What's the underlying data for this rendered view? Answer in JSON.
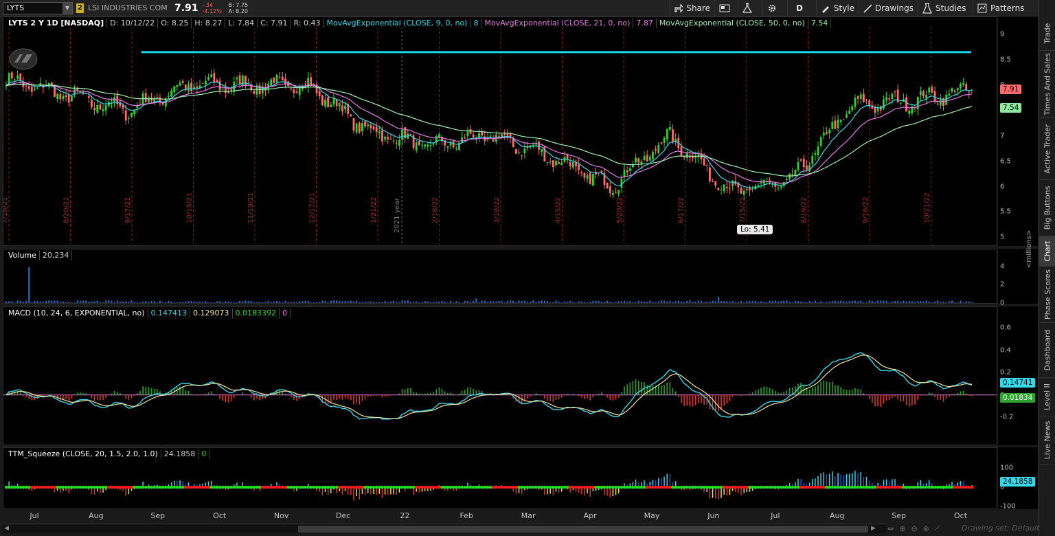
{
  "toolbar": {
    "symbol": "LYTS",
    "link_badge": "2",
    "company": "LSI INDUSTRIES COM",
    "last": "7.91",
    "change": "-.34",
    "change_pct": "-4.12%",
    "bid": "B: 7.75",
    "ask": "A: 8.20",
    "share": "Share",
    "period": "D",
    "style": "Style",
    "drawings": "Drawings",
    "studies": "Studies",
    "patterns": "Patterns"
  },
  "rail": [
    "Trade",
    "Times And Sales",
    "Active Trader",
    "Big Buttons",
    "Chart",
    "Phase Scores",
    "Dashboard",
    "Level II",
    "Live News"
  ],
  "price_panel": {
    "title": "LYTS 2 Y 1D [NASDAQ]",
    "date": "D: 10/12/22",
    "open": "O: 8.25",
    "high": "H: 8.27",
    "low": "L: 7.84",
    "close": "C: 7.91",
    "range": "R: 0.43",
    "ema9": "MovAvgExponential (CLOSE, 9, 0, no)",
    "ema9_val": "8",
    "ema21": "MovAvgExponential (CLOSE, 21, 0, no)",
    "ema21_val": "7.87",
    "ema50": "MovAvgExponential (CLOSE, 50, 0, no)",
    "ema50_val": "7.54",
    "axis": [
      "9",
      "8.5",
      "8",
      "7.5",
      "7",
      "6.5",
      "6",
      "5.5",
      "5"
    ],
    "tag_last": "7.91",
    "tag_ema": "7.54",
    "lo_label": "Lo: 5.41",
    "expiry_labels": [
      "7/16/21",
      "8/20/21",
      "9/17/21",
      "10/15/21",
      "11/19/21",
      "12/17/21",
      "1/21/22",
      "2/18/22",
      "3/18/22",
      "4/15/22",
      "5/20/22",
      "6/17/22",
      "7/15/22",
      "8/19/22",
      "9/16/22",
      "10/21/22"
    ],
    "year_label": "2021 year",
    "resistance": 8.65,
    "colors": {
      "up": "#2fd12f",
      "down": "#ff6b6b",
      "ema9": "#35d7e8",
      "ema21": "#e47ce4",
      "ema50": "#9ff0b0",
      "resistance": "#19d9ee"
    }
  },
  "volume_panel": {
    "title": "Volume",
    "value": "20,234",
    "axis": [
      "4",
      "2",
      "0"
    ],
    "unit": "<millions>"
  },
  "macd_panel": {
    "title": "MACD (10, 24, 6, EXPONENTIAL, no)",
    "v1": "0.147413",
    "v2": "0.129073",
    "v3": "0.0183392",
    "v4": "0",
    "axis": [
      "0.6",
      "0.4",
      "0.2",
      "0",
      "-0.2"
    ],
    "tag_value": "0.14741",
    "tag_diff": "0.01834"
  },
  "squeeze_panel": {
    "title": "TTM_Squeeze (CLOSE, 20, 1.5, 2.0, 1.0)",
    "v1": "24.1858",
    "v2": "0",
    "axis": [
      "100",
      "0",
      "-100"
    ],
    "tag_value": "24.1858"
  },
  "time_axis": [
    "Jul",
    "Aug",
    "Sep",
    "Oct",
    "Nov",
    "Dec",
    "22",
    "Feb",
    "Mar",
    "Apr",
    "May",
    "Jun",
    "Jul",
    "Aug",
    "Sep",
    "Oct"
  ],
  "drawing_set": "Drawing set: Default",
  "chart_data": {
    "type": "candlestick",
    "title": "LYTS 2 Y 1D [NASDAQ]",
    "ylim": [
      5,
      9.2
    ],
    "close_path_by_month": [
      {
        "month": "Jun 2021",
        "close": 8.1
      },
      {
        "month": "Jul 2021",
        "close": 7.8
      },
      {
        "month": "Aug 2021",
        "close": 7.5
      },
      {
        "month": "Sep 2021",
        "close": 8.0
      },
      {
        "month": "Oct 2021",
        "close": 8.0
      },
      {
        "month": "Nov 2021",
        "close": 8.0
      },
      {
        "month": "Dec 2021",
        "close": 7.1
      },
      {
        "month": "Jan 2022",
        "close": 6.8
      },
      {
        "month": "Feb 2022",
        "close": 7.0
      },
      {
        "month": "Mar 2022",
        "close": 6.6
      },
      {
        "month": "Apr 2022",
        "close": 6.0
      },
      {
        "month": "May 2022",
        "close": 7.0
      },
      {
        "month": "Jun 2022",
        "close": 5.9
      },
      {
        "month": "Jul 2022",
        "close": 6.1
      },
      {
        "month": "Aug 2022",
        "close": 7.6
      },
      {
        "month": "Sep 2022",
        "close": 7.7
      },
      {
        "month": "Oct 2022",
        "close": 7.91
      }
    ],
    "last_bar": {
      "date": "10/12/22",
      "open": 8.25,
      "high": 8.27,
      "low": 7.84,
      "close": 7.91
    },
    "low_marker": 5.41
  }
}
